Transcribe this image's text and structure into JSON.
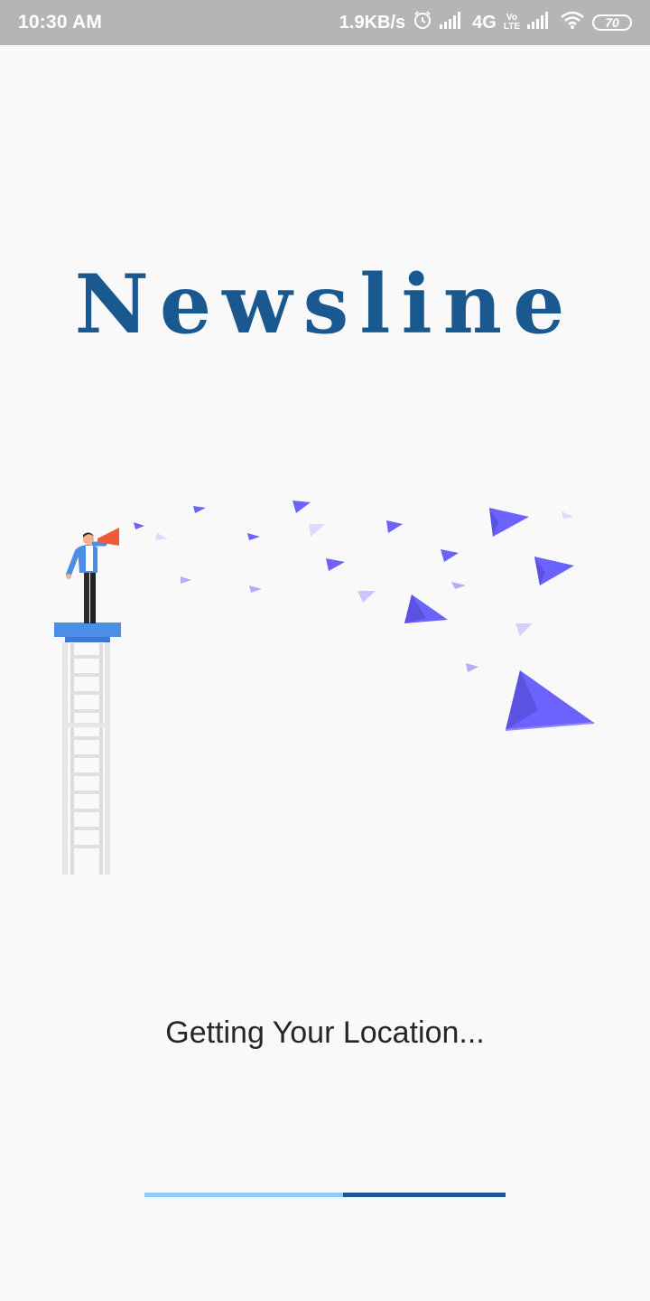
{
  "status_bar": {
    "time": "10:30 AM",
    "net_speed": "1.9KB/s",
    "network_type": "4G",
    "volte_top": "Vo",
    "volte_bottom": "LTE",
    "battery_level": "70",
    "icons": [
      "alarm-icon",
      "signal-icon",
      "volte-icon",
      "signal-icon",
      "wifi-icon",
      "battery-icon"
    ]
  },
  "app": {
    "title": "Newsline",
    "title_color": "#1a5990",
    "loading_text": "Getting Your Location...",
    "illustration": "person-megaphone-paper-planes",
    "progress": {
      "value": 0.45,
      "track_color": "#90caf9",
      "fill_color": "#1a5990"
    },
    "accent_color": "#6c63ff"
  }
}
